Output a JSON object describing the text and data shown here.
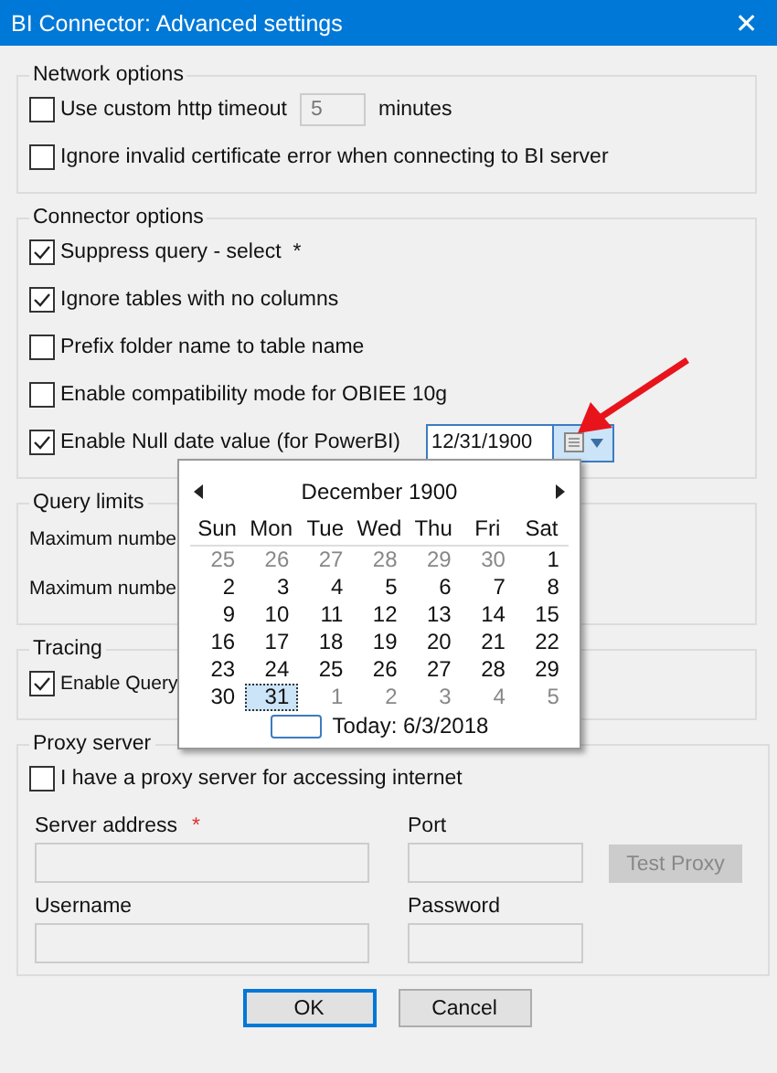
{
  "window": {
    "title": "BI Connector: Advanced settings",
    "close": "✕"
  },
  "network": {
    "title": "Network options",
    "timeout": {
      "label": "Use custom http timeout",
      "checked": false,
      "value": "5",
      "unit": "minutes"
    },
    "ignore_cert": {
      "label": "Ignore invalid certificate error when connecting to BI server",
      "checked": false
    }
  },
  "connector": {
    "title": "Connector options",
    "options": [
      {
        "label": "Suppress query - select  *",
        "checked": true
      },
      {
        "label": "Ignore tables with no columns",
        "checked": true
      },
      {
        "label": "Prefix folder name to table name",
        "checked": false
      },
      {
        "label": "Enable compatibility mode for OBIEE 10g",
        "checked": false
      },
      {
        "label": "Enable Null date value (for PowerBI)",
        "checked": true
      }
    ],
    "date_value": "12/31/1900"
  },
  "query_limits": {
    "title": "Query limits",
    "rows": [
      "Maximum numbe",
      "Maximum numbe"
    ]
  },
  "tracing": {
    "title": "Tracing",
    "option": {
      "label": "Enable Query",
      "checked": true
    }
  },
  "calendar": {
    "month": "December 1900",
    "weekdays": [
      "Sun",
      "Mon",
      "Tue",
      "Wed",
      "Thu",
      "Fri",
      "Sat"
    ],
    "days": [
      {
        "day": "25",
        "muted": true,
        "selected": false
      },
      {
        "day": "26",
        "muted": true,
        "selected": false
      },
      {
        "day": "27",
        "muted": true,
        "selected": false
      },
      {
        "day": "28",
        "muted": true,
        "selected": false
      },
      {
        "day": "29",
        "muted": true,
        "selected": false
      },
      {
        "day": "30",
        "muted": true,
        "selected": false
      },
      {
        "day": "1",
        "muted": false,
        "selected": false
      },
      {
        "day": "2",
        "muted": false,
        "selected": false
      },
      {
        "day": "3",
        "muted": false,
        "selected": false
      },
      {
        "day": "4",
        "muted": false,
        "selected": false
      },
      {
        "day": "5",
        "muted": false,
        "selected": false
      },
      {
        "day": "6",
        "muted": false,
        "selected": false
      },
      {
        "day": "7",
        "muted": false,
        "selected": false
      },
      {
        "day": "8",
        "muted": false,
        "selected": false
      },
      {
        "day": "9",
        "muted": false,
        "selected": false
      },
      {
        "day": "10",
        "muted": false,
        "selected": false
      },
      {
        "day": "11",
        "muted": false,
        "selected": false
      },
      {
        "day": "12",
        "muted": false,
        "selected": false
      },
      {
        "day": "13",
        "muted": false,
        "selected": false
      },
      {
        "day": "14",
        "muted": false,
        "selected": false
      },
      {
        "day": "15",
        "muted": false,
        "selected": false
      },
      {
        "day": "16",
        "muted": false,
        "selected": false
      },
      {
        "day": "17",
        "muted": false,
        "selected": false
      },
      {
        "day": "18",
        "muted": false,
        "selected": false
      },
      {
        "day": "19",
        "muted": false,
        "selected": false
      },
      {
        "day": "20",
        "muted": false,
        "selected": false
      },
      {
        "day": "21",
        "muted": false,
        "selected": false
      },
      {
        "day": "22",
        "muted": false,
        "selected": false
      },
      {
        "day": "23",
        "muted": false,
        "selected": false
      },
      {
        "day": "24",
        "muted": false,
        "selected": false
      },
      {
        "day": "25",
        "muted": false,
        "selected": false
      },
      {
        "day": "26",
        "muted": false,
        "selected": false
      },
      {
        "day": "27",
        "muted": false,
        "selected": false
      },
      {
        "day": "28",
        "muted": false,
        "selected": false
      },
      {
        "day": "29",
        "muted": false,
        "selected": false
      },
      {
        "day": "30",
        "muted": false,
        "selected": false
      },
      {
        "day": "31",
        "muted": false,
        "selected": true
      },
      {
        "day": "1",
        "muted": true,
        "selected": false
      },
      {
        "day": "2",
        "muted": true,
        "selected": false
      },
      {
        "day": "3",
        "muted": true,
        "selected": false
      },
      {
        "day": "4",
        "muted": true,
        "selected": false
      },
      {
        "day": "5",
        "muted": true,
        "selected": false
      }
    ],
    "today": "Today: 6/3/2018"
  },
  "proxy": {
    "title": "Proxy server",
    "option": {
      "label": "I have a proxy server for accessing internet",
      "checked": false
    },
    "server_label": "Server address",
    "required": "*",
    "port_label": "Port",
    "test_button": "Test Proxy",
    "username_label": "Username",
    "password_label": "Password"
  },
  "buttons": [
    {
      "label": "OK",
      "default": true
    },
    {
      "label": "Cancel",
      "default": false
    }
  ]
}
